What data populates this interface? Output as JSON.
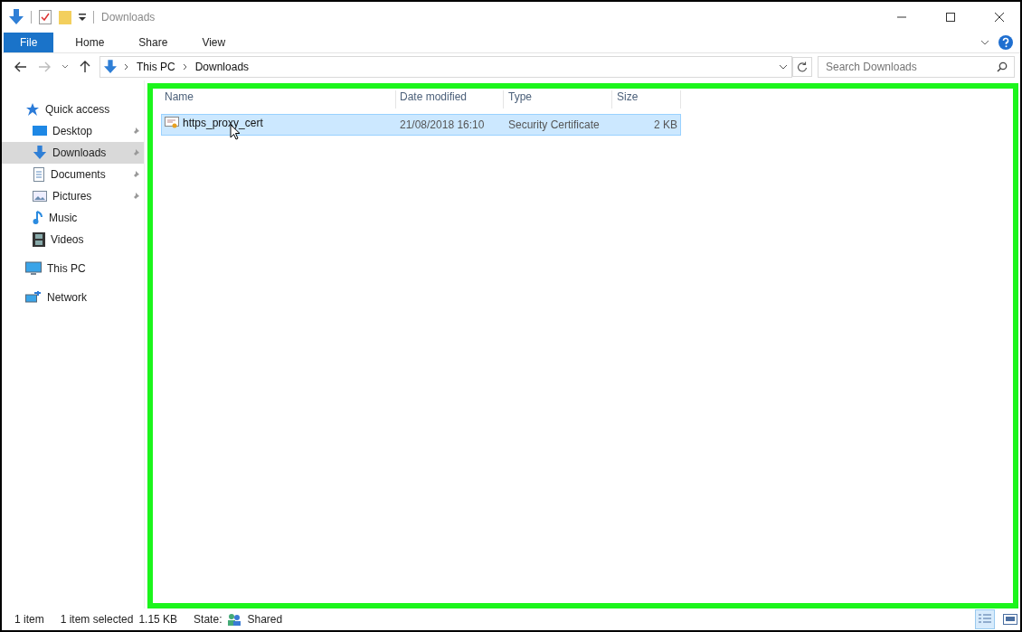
{
  "window": {
    "title": "Downloads"
  },
  "ribbon_tabs": [
    {
      "label": "File",
      "selected": true
    },
    {
      "label": "Home",
      "selected": false
    },
    {
      "label": "Share",
      "selected": false
    },
    {
      "label": "View",
      "selected": false
    }
  ],
  "address": {
    "path": [
      "This PC",
      "Downloads"
    ]
  },
  "search": {
    "placeholder": "Search Downloads"
  },
  "sidebar": {
    "items": [
      {
        "label": "Quick access",
        "kind": "star",
        "selected": false,
        "children": [
          {
            "label": "Desktop",
            "kind": "desktop",
            "pinned": true,
            "selected": false
          },
          {
            "label": "Downloads",
            "kind": "download",
            "pinned": true,
            "selected": true
          },
          {
            "label": "Documents",
            "kind": "document",
            "pinned": true,
            "selected": false
          },
          {
            "label": "Pictures",
            "kind": "picture",
            "pinned": true,
            "selected": false
          },
          {
            "label": "Music",
            "kind": "music",
            "pinned": false,
            "selected": false
          },
          {
            "label": "Videos",
            "kind": "video",
            "pinned": false,
            "selected": false
          }
        ]
      },
      {
        "label": "This PC",
        "kind": "pc",
        "selected": false
      },
      {
        "label": "Network",
        "kind": "network",
        "selected": false
      }
    ]
  },
  "table": {
    "columns": [
      "Name",
      "Date modified",
      "Type",
      "Size"
    ],
    "rows": [
      {
        "name": "https_proxy_cert",
        "date": "21/08/2018 16:10",
        "type": "Security Certificate",
        "size": "2 KB",
        "selected": true
      }
    ]
  },
  "status_bar": {
    "count": "1 item",
    "selection": "1 item selected",
    "selection_size": "1.15 KB",
    "state_label": "State:",
    "state": "Shared",
    "view_details_selected": true
  }
}
